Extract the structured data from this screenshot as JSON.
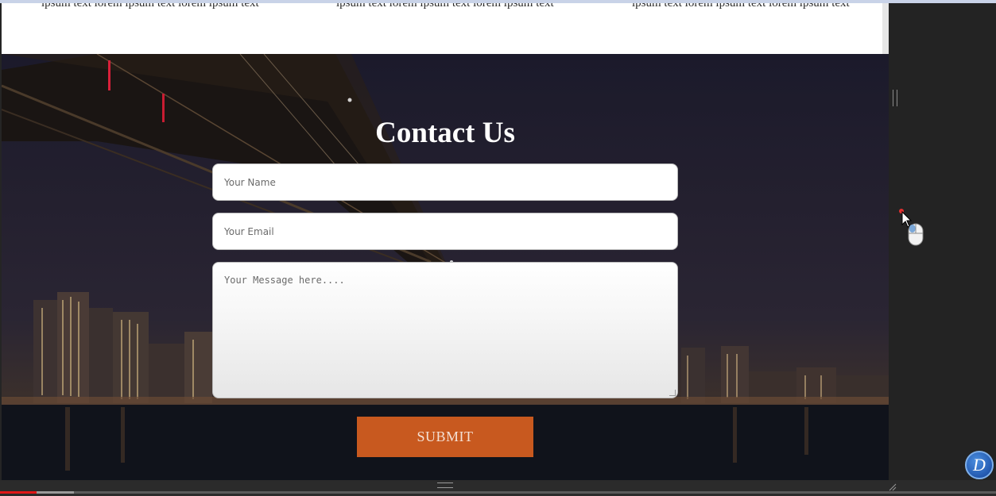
{
  "strip": {
    "col1": "ipsum text lorem ipsum text lorem ipsum text",
    "col2": "ipsum text lorem ipsum text lorem ipsum text",
    "col3": "ipsum text lorem ipsum text lorem ipsum text"
  },
  "contact": {
    "title": "Contact Us",
    "name_placeholder": "Your Name",
    "email_placeholder": "Your Email",
    "message_placeholder": "Your Message here....",
    "submit_label": "SUBMIT"
  },
  "icons": {
    "cursor": "mouse-cursor-icon",
    "logo": "d-logo-icon",
    "logo_letter": "D"
  },
  "video": {
    "played_fraction": 0.037,
    "buffered_fraction": 0.074
  },
  "colors": {
    "submit_bg": "#c8591f",
    "progress_played": "#e01818"
  }
}
